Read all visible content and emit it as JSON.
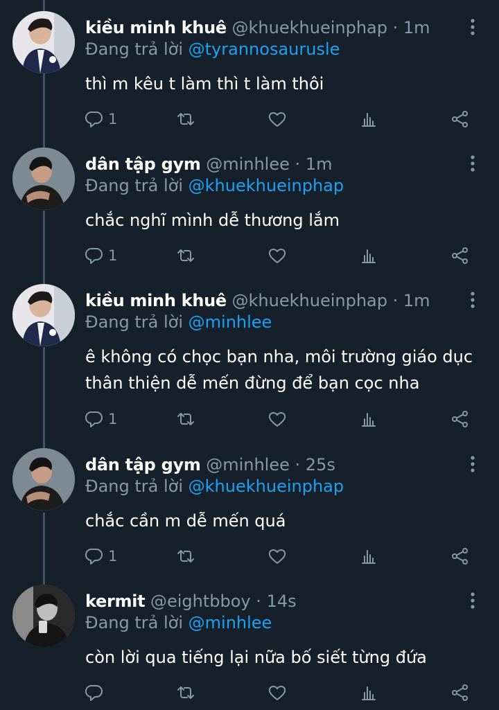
{
  "tweets": [
    {
      "name": "kiều minh khuê",
      "handle": "@khuekhueinphap",
      "dot": "·",
      "time": "1m",
      "reply_label": "Đang trả lời",
      "reply_to": "@tyrannosaurusle",
      "text": "thì m kêu t làm thì t làm thôi",
      "reply_count": "1"
    },
    {
      "name": "dân tập gym",
      "handle": "@minhlee",
      "dot": "·",
      "time": "1m",
      "reply_label": "Đang trả lời",
      "reply_to": "@khuekhueinphap",
      "text": "chắc nghĩ mình dễ thương lắm",
      "reply_count": "1"
    },
    {
      "name": "kiều minh khuê",
      "handle": "@khuekhueinphap",
      "dot": "·",
      "time": "1m",
      "reply_label": "Đang trả lời",
      "reply_to": "@minhlee",
      "text": "ê không có chọc bạn nha, môi trường giáo dục thân thiện dễ mến đừng để bạn cọc nha",
      "reply_count": "1"
    },
    {
      "name": "dân tập gym",
      "handle": "@minhlee",
      "dot": "·",
      "time": "25s",
      "reply_label": "Đang trả lời",
      "reply_to": "@khuekhueinphap",
      "text": "chắc cần m dễ mến quá",
      "reply_count": "1"
    },
    {
      "name": "kermit",
      "handle": "@eightbboy",
      "dot": "·",
      "time": "14s",
      "reply_label": "Đang trả lời",
      "reply_to": "@minhlee",
      "text": "còn lời qua tiếng lại nữa bố siết từng đứa",
      "reply_count": ""
    }
  ],
  "icons": {
    "reply": "reply-icon",
    "retweet": "retweet-icon",
    "like": "heart-icon",
    "stats": "stats-icon",
    "share": "share-icon",
    "more": "more-icon"
  },
  "colors": {
    "background": "#15202b",
    "muted": "#8899a6",
    "link": "#1da1f2",
    "thread_line": "#3d5466"
  }
}
